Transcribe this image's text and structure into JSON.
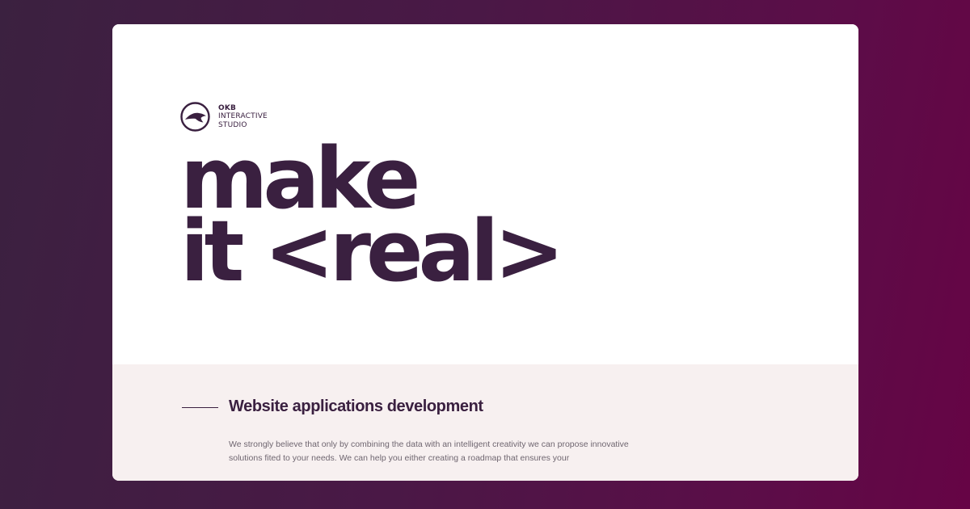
{
  "logo": {
    "icon": "bird-in-circle-icon",
    "line1": "OKB",
    "line2": "INTERACTIVE",
    "line3": "STUDIO"
  },
  "hero": {
    "headline_line1": "make",
    "headline_line2": "it <real>"
  },
  "section": {
    "title": "Website applications development",
    "body": "We strongly believe that only by combining the data with an intelligent creativity we can propose innovative solutions fited to your needs. We can help you either creating a roadmap that ensures your"
  },
  "colors": {
    "brand": "#3a2040",
    "background_start": "#3b2140",
    "background_end": "#660445",
    "section_bg": "#f7f0f0"
  }
}
